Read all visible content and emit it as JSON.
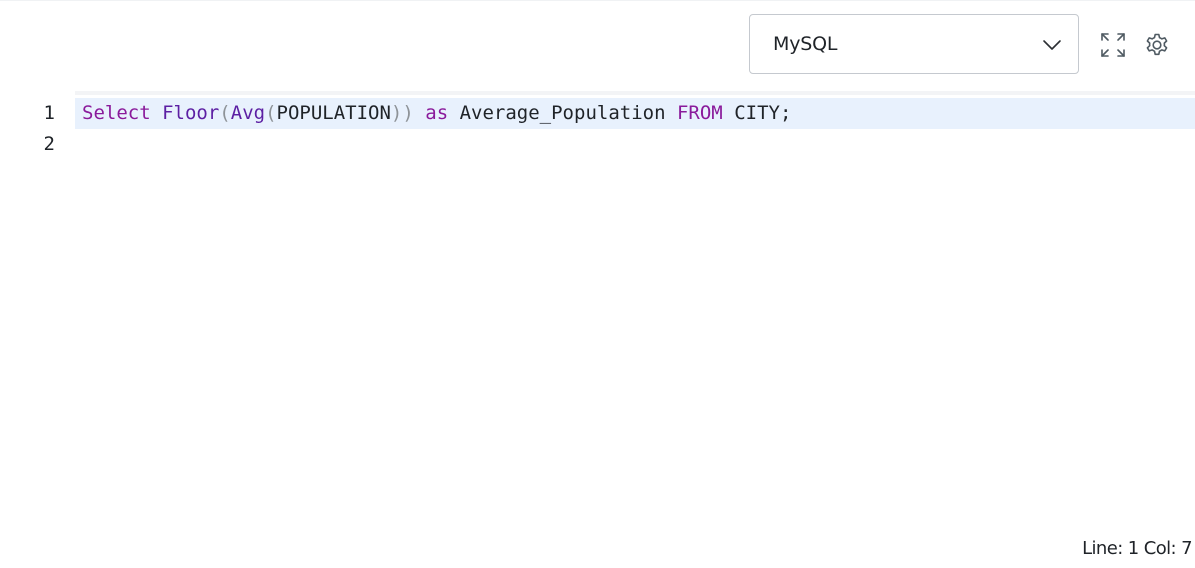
{
  "toolbar": {
    "language": {
      "selected": "MySQL",
      "icon": "chevron-down-icon"
    },
    "fullscreen_icon": "expand-icon",
    "settings_icon": "gear-icon"
  },
  "editor": {
    "lines": [
      {
        "number": "1",
        "tokens": [
          {
            "type": "keyword",
            "text": "Select"
          },
          {
            "type": "space",
            "text": " "
          },
          {
            "type": "func",
            "text": "Floor"
          },
          {
            "type": "paren",
            "text": "("
          },
          {
            "type": "func",
            "text": "Avg"
          },
          {
            "type": "paren",
            "text": "("
          },
          {
            "type": "ident",
            "text": "POPULATION"
          },
          {
            "type": "paren",
            "text": "))"
          },
          {
            "type": "space",
            "text": " "
          },
          {
            "type": "keyword",
            "text": "as"
          },
          {
            "type": "space",
            "text": " "
          },
          {
            "type": "ident",
            "text": "Average_Population"
          },
          {
            "type": "space",
            "text": " "
          },
          {
            "type": "keyword",
            "text": "FROM"
          },
          {
            "type": "space",
            "text": " "
          },
          {
            "type": "ident",
            "text": "CITY;"
          }
        ]
      },
      {
        "number": "2",
        "tokens": []
      }
    ]
  },
  "status": {
    "text": "Line: 1 Col: 7"
  },
  "colors": {
    "keyword": "#8a1a9b",
    "function": "#5c1fa3",
    "paren": "#8e9398",
    "active_line": "#e8f1fd"
  }
}
